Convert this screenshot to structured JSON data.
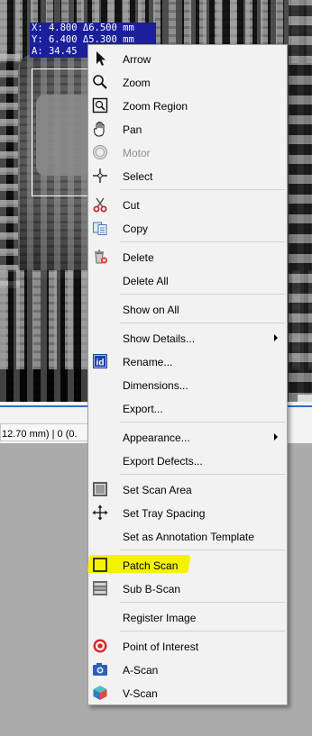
{
  "coords": {
    "line1": "X: 4.800 Δ6.500 mm",
    "line2": "Y: 6.400 Δ5.300 mm",
    "line3": "A: 34.45"
  },
  "status_bar": {
    "text": "12.70 mm)  |  0 (0."
  },
  "highlight_color": "#f5f200",
  "menu": {
    "items": [
      {
        "label": "Arrow",
        "icon": "arrow-cursor-icon"
      },
      {
        "label": "Zoom",
        "icon": "magnifier-icon"
      },
      {
        "label": "Zoom Region",
        "icon": "zoom-region-icon"
      },
      {
        "label": "Pan",
        "icon": "hand-icon"
      },
      {
        "label": "Motor",
        "icon": "motor-icon",
        "disabled": true
      },
      {
        "label": "Select",
        "icon": "crosshair-icon"
      },
      {
        "label": "Cut",
        "icon": "scissors-icon"
      },
      {
        "label": "Copy",
        "icon": "copy-icon"
      },
      {
        "label": "Delete",
        "icon": "trash-icon"
      },
      {
        "label": "Delete All"
      },
      {
        "label": "Show on All"
      },
      {
        "label": "Show Details...",
        "submenu": true
      },
      {
        "label": "Rename...",
        "icon": "rename-id-icon"
      },
      {
        "label": "Dimensions..."
      },
      {
        "label": "Export..."
      },
      {
        "label": "Appearance...",
        "submenu": true
      },
      {
        "label": "Export Defects..."
      },
      {
        "label": "Set Scan Area",
        "icon": "scan-area-icon"
      },
      {
        "label": "Set Tray Spacing",
        "icon": "move-arrows-icon"
      },
      {
        "label": "Set as Annotation Template"
      },
      {
        "label": "Patch Scan",
        "icon": "patch-scan-icon",
        "highlighted": true
      },
      {
        "label": "Sub B-Scan",
        "icon": "sub-b-scan-icon"
      },
      {
        "label": "Register Image"
      },
      {
        "label": "Point of Interest",
        "icon": "target-icon"
      },
      {
        "label": "A-Scan",
        "icon": "camera-icon"
      },
      {
        "label": "V-Scan",
        "icon": "cube-icon"
      }
    ]
  }
}
